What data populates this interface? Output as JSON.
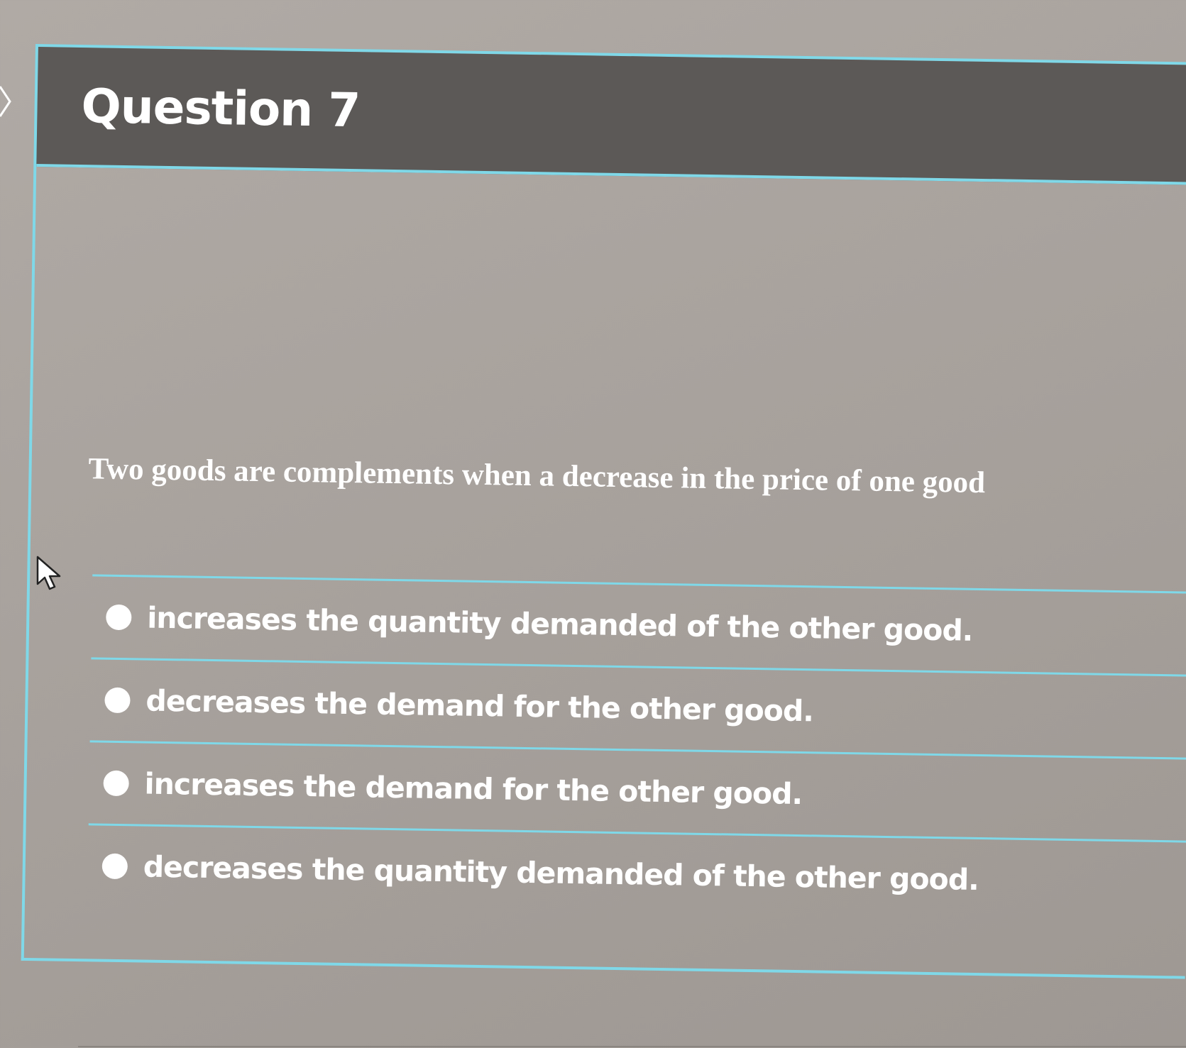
{
  "question": {
    "title": "Question 7",
    "text": "Two goods are complements when a decrease in the price of one good"
  },
  "answers": [
    {
      "label": "increases the quantity demanded of the other good.",
      "selected": false
    },
    {
      "label": "decreases the demand for the other good.",
      "selected": false
    },
    {
      "label": "increases the demand for the other good.",
      "selected": false
    },
    {
      "label": "decreases the quantity demanded of the other good.",
      "selected": false
    }
  ],
  "colors": {
    "accent": "#7fd8e8",
    "header_bg": "#5c5957",
    "text": "#ffffff"
  },
  "icons": {
    "left_nav": "chevron-right-icon",
    "cursor": "mouse-pointer-icon",
    "radio": "radio-button"
  }
}
